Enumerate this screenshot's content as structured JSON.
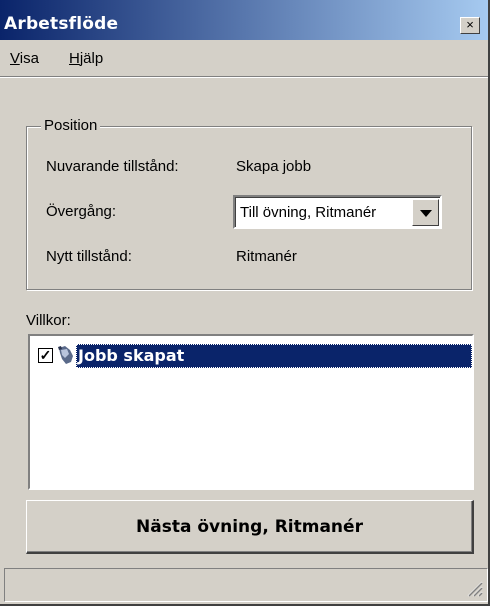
{
  "window": {
    "title": "Arbetsflöde",
    "close_glyph": "×"
  },
  "menubar": {
    "items": [
      {
        "label": "Visa",
        "mnemonic": "V",
        "rest": "isa"
      },
      {
        "label": "Hjälp",
        "mnemonic": "H",
        "rest": "jälp"
      }
    ]
  },
  "position": {
    "legend": "Position",
    "current_state_label": "Nuvarande tillstånd:",
    "current_state_value": "Skapa jobb",
    "transition_label": "Övergång:",
    "transition_selected": "Till övning, Ritmanér",
    "new_state_label": "Nytt tillstånd:",
    "new_state_value": "Ritmanér"
  },
  "conditions": {
    "label": "Villkor:",
    "items": [
      {
        "label": "Jobb skapat",
        "checked": true,
        "icon": "dog-icon",
        "selected": true
      }
    ]
  },
  "action_button": {
    "label": "Nästa övning, Ritmanér"
  },
  "statusbar": {
    "text": ""
  },
  "colors": {
    "titlebar_start": "#0a246a",
    "titlebar_end": "#a6caf0",
    "face": "#d4d0c8",
    "selection": "#0a246a"
  }
}
